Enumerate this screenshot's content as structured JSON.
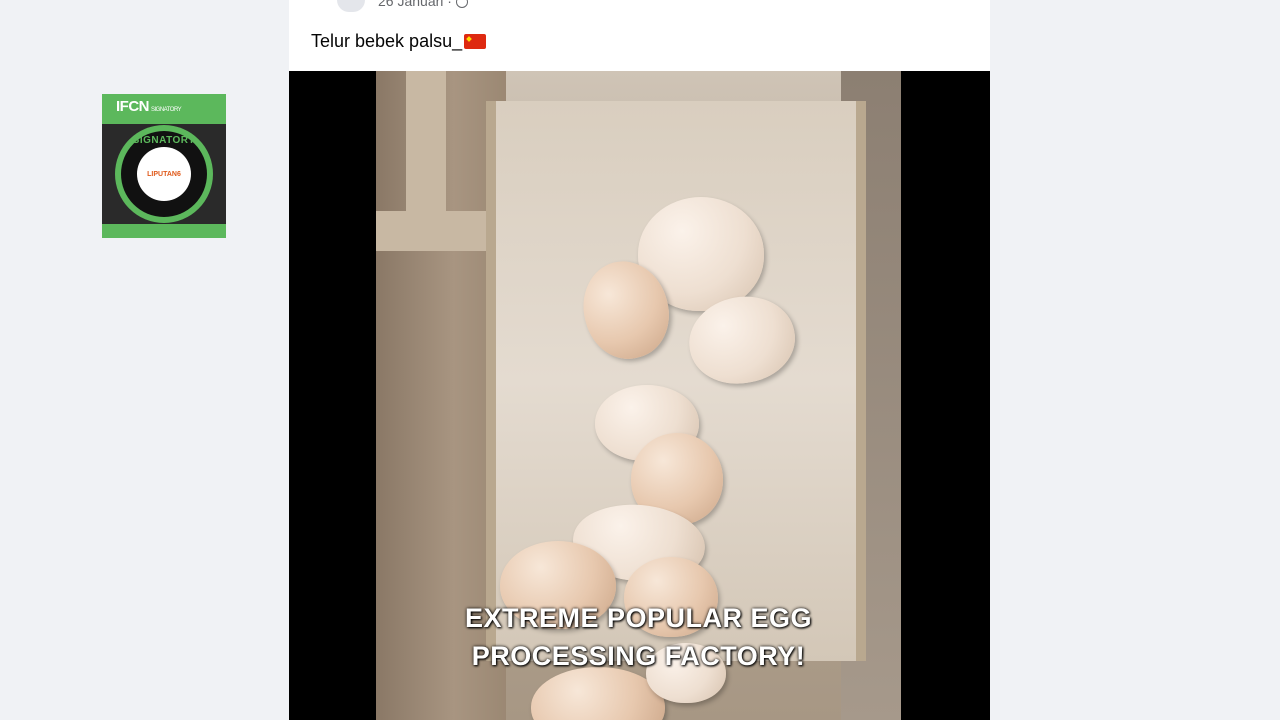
{
  "badge": {
    "logo_text": "IFCN",
    "logo_small": "SIGNATORY",
    "ring_text": "SIGNATORY",
    "center_text": "LIPUTAN6",
    "colors": {
      "green": "#5cb85c",
      "dark": "#111111",
      "orange": "#e05a1b"
    }
  },
  "post": {
    "date": "26 Januari ·",
    "text": "Telur bebek palsu_",
    "text_icon": "china-flag-icon",
    "privacy_icon": "globe-icon"
  },
  "video": {
    "caption_line1": "EXTREME POPULAR EGG",
    "caption_line2": "PROCESSING FACTORY!"
  }
}
